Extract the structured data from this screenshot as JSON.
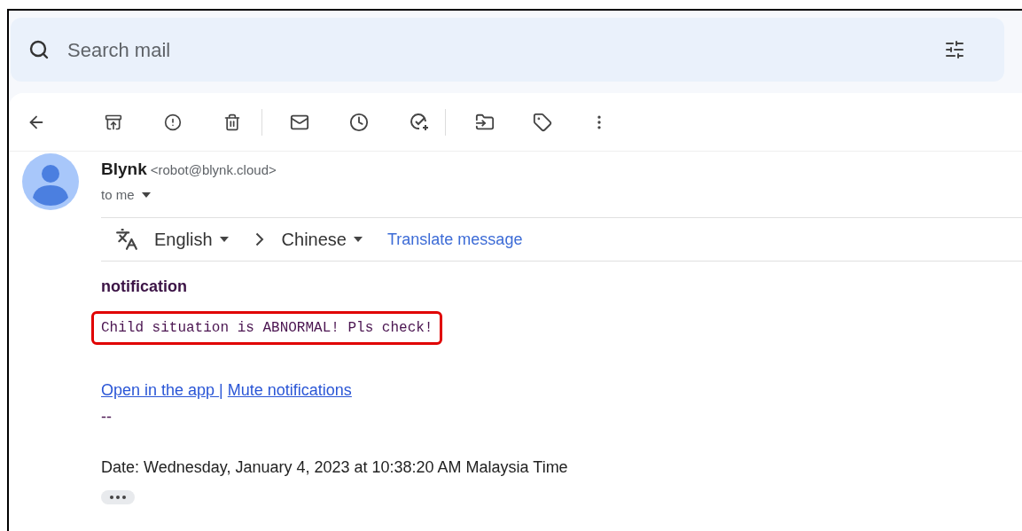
{
  "search": {
    "placeholder": "Search mail"
  },
  "sender": {
    "name": "Blynk",
    "email": "<robot@blynk.cloud>",
    "recipient": "to me"
  },
  "translate": {
    "from": "English",
    "to": "Chinese",
    "action": "Translate message"
  },
  "body": {
    "heading": "notification",
    "message": "Child situation is ABNORMAL! Pls check!",
    "links": [
      {
        "label": "Open in the app "
      },
      {
        "label": "Mute notifications"
      }
    ],
    "link_separator": "|",
    "signature_dash": "--",
    "date": "Date: Wednesday, January 4, 2023 at 10:38:20 AM Malaysia Time"
  }
}
